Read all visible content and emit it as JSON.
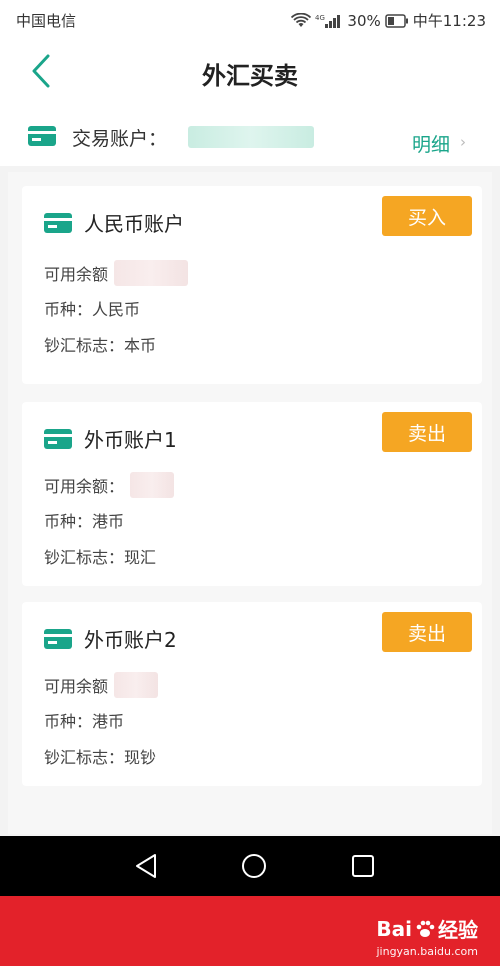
{
  "status_bar": {
    "carrier": "中国电信",
    "battery": "30%",
    "time": "中午11:23"
  },
  "header": {
    "title": "外汇买卖"
  },
  "account_row": {
    "label": "交易账户：",
    "detail": "明细",
    "chevron": "›"
  },
  "cards": [
    {
      "title": "人民币账户",
      "action": "买入",
      "balance_label": "可用余额",
      "currency_line": "币种：人民币",
      "flag_line": "钞汇标志：本币"
    },
    {
      "title": "外币账户1",
      "action": "卖出",
      "balance_label": "可用余额：",
      "currency_line": "币种：港币",
      "flag_line": "钞汇标志：现汇"
    },
    {
      "title": "外币账户2",
      "action": "卖出",
      "balance_label": "可用余额",
      "currency_line": "币种：港币",
      "flag_line": "钞汇标志：现钞"
    }
  ],
  "watermark": {
    "brand": "Bai",
    "brand_suffix": "经验",
    "url": "jingyan.baidu.com"
  },
  "colors": {
    "accent_green": "#1aa58a",
    "button_orange": "#f5a623",
    "banner_red": "#e3222a"
  }
}
